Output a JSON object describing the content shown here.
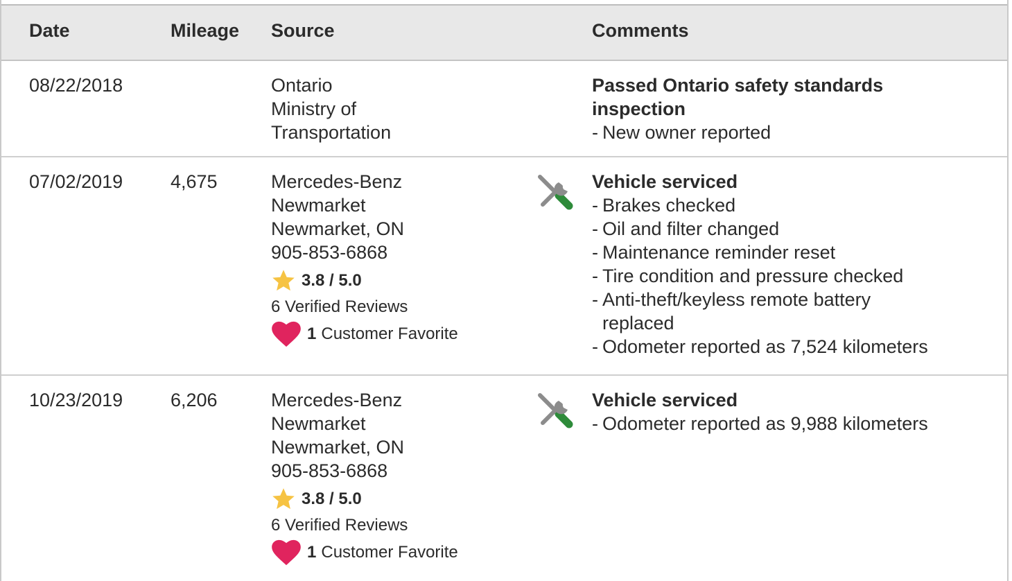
{
  "columns": {
    "date": "Date",
    "mileage": "Mileage",
    "source": "Source",
    "comments": "Comments"
  },
  "rows": [
    {
      "date": "08/22/2018",
      "mileage": "",
      "source": [
        "Ontario",
        "Ministry of",
        "Transportation"
      ],
      "comments": {
        "title_lines": [
          "Passed Ontario safety standards",
          "inspection"
        ],
        "items": [
          "New owner reported"
        ]
      }
    },
    {
      "date": "07/02/2019",
      "mileage": "4,675",
      "source": [
        "Mercedes-Benz",
        "Newmarket",
        "Newmarket, ON",
        "905-853-6868"
      ],
      "rating": "3.8 / 5.0",
      "reviews": "6 Verified Reviews",
      "favorite_count": "1",
      "favorite_label": "Customer Favorite",
      "icon": "service-tools-icon",
      "comments": {
        "title_lines": [
          "Vehicle serviced"
        ],
        "items": [
          "Brakes checked",
          "Oil and filter changed",
          "Maintenance reminder reset",
          "Tire condition and pressure checked",
          "Anti-theft/keyless remote battery replaced",
          "Odometer reported as 7,524 kilometers"
        ]
      }
    },
    {
      "date": "10/23/2019",
      "mileage": "6,206",
      "source": [
        "Mercedes-Benz",
        "Newmarket",
        "Newmarket, ON",
        "905-853-6868"
      ],
      "rating": "3.8 / 5.0",
      "reviews": "6 Verified Reviews",
      "favorite_count": "1",
      "favorite_label": "Customer Favorite",
      "icon": "service-tools-icon",
      "comments": {
        "title_lines": [
          "Vehicle serviced"
        ],
        "items": [
          "Odometer reported as 9,988 kilometers"
        ]
      }
    }
  ],
  "colors": {
    "header_bg": "#e8e8e8",
    "star": "#f6c343",
    "heart": "#e0245e",
    "tool_gray": "#8c8c8c",
    "tool_green": "#2e8b3a"
  }
}
